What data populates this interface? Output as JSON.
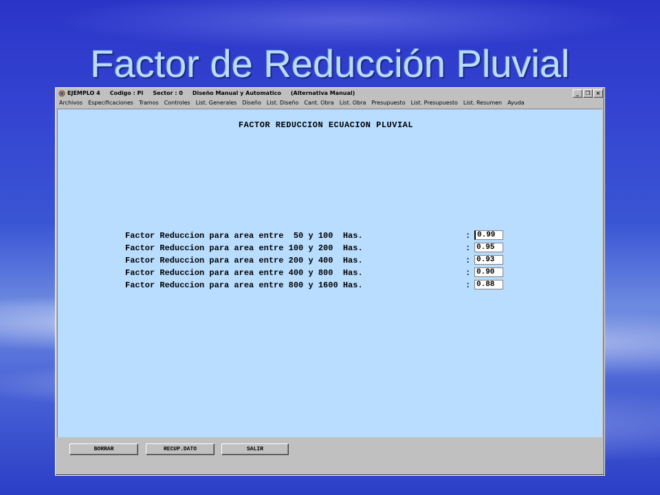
{
  "slide": {
    "title": "Factor de Reducción Pluvial"
  },
  "window": {
    "title_segments": [
      "EJEMPLO 4",
      "Codigo : PI",
      "Sector : 0",
      "Diseño Manual y Automatico",
      "(Alternativa Manual)"
    ],
    "controls": {
      "minimize": "_",
      "restore": "❐",
      "close": "×"
    }
  },
  "menu": [
    "Archivos",
    "Especificaciones",
    "Tramos",
    "Controles",
    "List. Generales",
    "Diseño",
    "List. Diseño",
    "Cant. Obra",
    "List. Obra",
    "Presupuesto",
    "List. Presupuesto",
    "List. Resumen",
    "Ayuda"
  ],
  "form": {
    "title": "FACTOR REDUCCION ECUACION PLUVIAL",
    "rows": [
      {
        "label": "Factor Reduccion para area entre  50 y 100  Has.",
        "colon": ":",
        "value": "0.99"
      },
      {
        "label": "Factor Reduccion para area entre 100 y 200  Has.",
        "colon": ":",
        "value": "0.95"
      },
      {
        "label": "Factor Reduccion para area entre 200 y 400  Has.",
        "colon": ":",
        "value": "0.93"
      },
      {
        "label": "Factor Reduccion para area entre 400 y 800  Has.",
        "colon": ":",
        "value": "0.90"
      },
      {
        "label": "Factor Reduccion para area entre 800 y 1600 Has.",
        "colon": ":",
        "value": "0.88"
      }
    ]
  },
  "buttons": {
    "borrar": "BORRAR",
    "recup": "RECUP.DATO",
    "salir": "SALIR"
  },
  "colors": {
    "client_bg": "#b9ddff",
    "window_bg": "#c0c0c0",
    "slide_title": "#b9dcff"
  }
}
